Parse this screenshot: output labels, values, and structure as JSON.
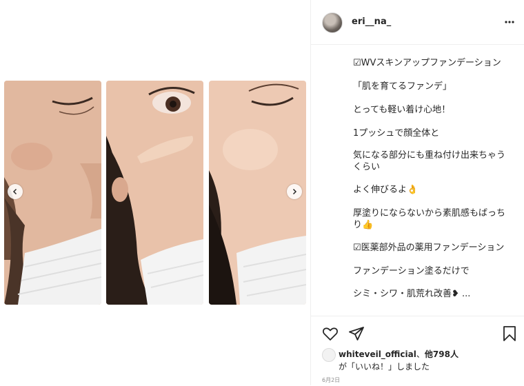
{
  "post": {
    "username": "eri__na_",
    "icons": {
      "more": "more-dots-icon",
      "like": "heart-icon",
      "share": "paper-plane-icon",
      "save": "bookmark-icon",
      "prev": "chevron-left-icon",
      "next": "chevron-right-icon"
    },
    "caption_lines": [
      "☑WVスキンアップファンデーション",
      "「肌を育てるファンデ」",
      "とっても軽い着け心地！",
      "1プッシュで顔全体と",
      "気になる部分にも重ね付け出来ちゃう",
      "くらい",
      "よく伸びるよ👌",
      "厚塗りにならないから素肌感もばっち",
      "り👍",
      "☑医薬部外品の薬用ファンデーション",
      "ファンデーション塗るだけで",
      "シミ・シワ・肌荒れ改善❥ ..."
    ],
    "likes": {
      "user": "whiteveil_official",
      "sep": "、",
      "others": "他798人",
      "suffix": "が「いいね！」しました"
    },
    "date": "6月2日"
  },
  "colors": {
    "text": "#262626",
    "muted": "#8e8e8e",
    "border": "#efefef"
  }
}
